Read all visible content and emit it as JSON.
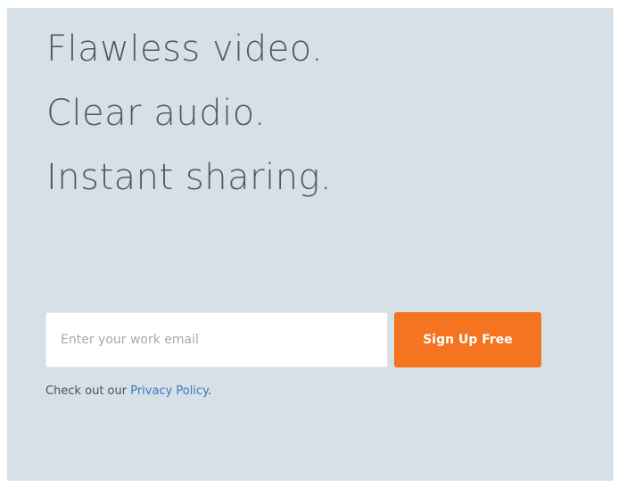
{
  "headline": {
    "line1": "Flawless video.",
    "line2": "Clear audio.",
    "line3": "Instant sharing."
  },
  "signup": {
    "email_placeholder": "Enter your work email",
    "email_value": "",
    "button_label": "Sign Up Free"
  },
  "privacy": {
    "prefix": "Check out our ",
    "link_label": "Privacy Policy",
    "suffix": "."
  },
  "colors": {
    "background": "#d7e0e6",
    "headline_text": "#4e5a63",
    "button_accent": "#f47420",
    "link": "#3a78c2"
  }
}
